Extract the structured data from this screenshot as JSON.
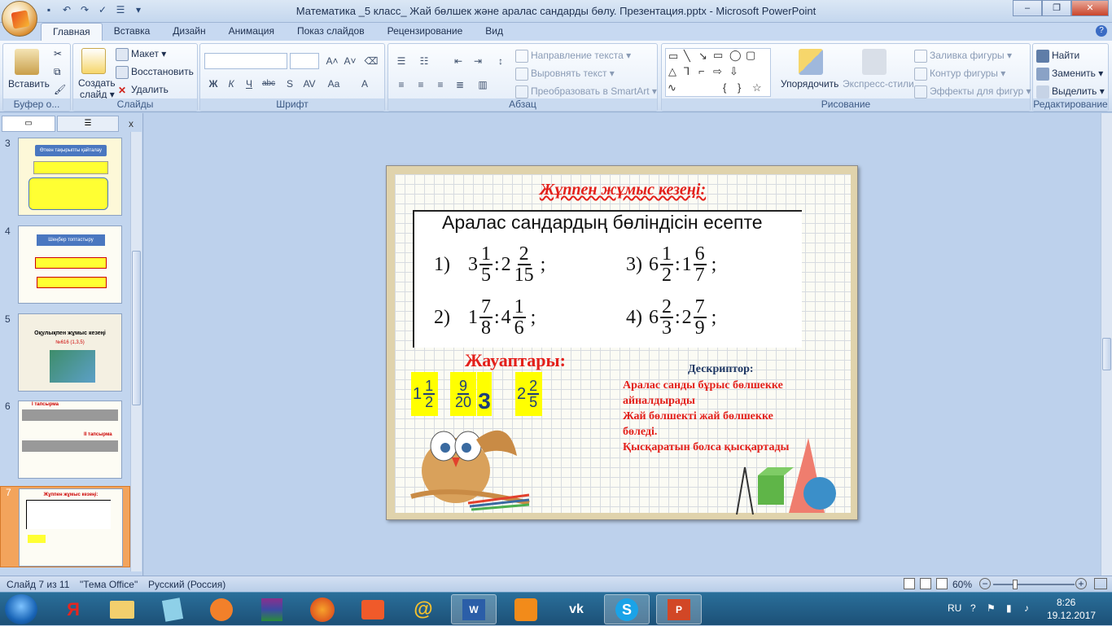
{
  "window": {
    "title": "Математика _5 класс_ Жай бөлшек және аралас сандарды бөлу. Презентация.pptx - Microsoft PowerPoint",
    "minimize": "–",
    "maximize": "❐",
    "close": "✕"
  },
  "tabs": [
    "Главная",
    "Вставка",
    "Дизайн",
    "Анимация",
    "Показ слайдов",
    "Рецензирование",
    "Вид"
  ],
  "ribbon": {
    "clipboard": {
      "label": "Буфер о...",
      "paste": "Вставить"
    },
    "slides": {
      "label": "Слайды",
      "new_slide": "Создать",
      "new_slide2": "слайд ▾",
      "layout": "Макет ▾",
      "reset": "Восстановить",
      "delete": "Удалить"
    },
    "font": {
      "label": "Шрифт"
    },
    "paragraph": {
      "label": "Абзац",
      "text_direction": "Направление текста ▾",
      "align_text": "Выровнять текст ▾",
      "smartart": "Преобразовать в SmartArt ▾"
    },
    "drawing": {
      "label": "Рисование",
      "arrange": "Упорядочить",
      "quick_styles": "Экспресс-стили",
      "fill": "Заливка фигуры ▾",
      "outline": "Контур фигуры ▾",
      "effects": "Эффекты для фигур ▾"
    },
    "editing": {
      "label": "Редактирование",
      "find": "Найти",
      "replace": "Заменить ▾",
      "select": "Выделить ▾"
    }
  },
  "thumbnails": [
    {
      "num": "3",
      "title": "Өткен тақырыпты қайталау"
    },
    {
      "num": "4",
      "title": "Шеңбер топтастыру"
    },
    {
      "num": "5",
      "title": "Оқулықпен жұмыс кезеңі",
      "sub": "№616 (1,3,5)"
    },
    {
      "num": "6",
      "title": "І тапсырма",
      "sub": "ІІ тапсырма"
    },
    {
      "num": "7",
      "title": "Жұппен жұмыс кезеңі:"
    }
  ],
  "slide": {
    "title": "Жұппен жұмыс  кезеңі:",
    "task_heading": "Аралас сандардың бөліндісін есепте",
    "problems": [
      {
        "num": "1)",
        "a_whole": "3",
        "a_n": "1",
        "a_d": "5",
        "b_whole": "2",
        "b_n": "2",
        "b_d": "15"
      },
      {
        "num": "3)",
        "a_whole": "6",
        "a_n": "1",
        "a_d": "2",
        "b_whole": "1",
        "b_n": "6",
        "b_d": "7"
      },
      {
        "num": "2)",
        "a_whole": "1",
        "a_n": "7",
        "a_d": "8",
        "b_whole": "4",
        "b_n": "1",
        "b_d": "6"
      },
      {
        "num": "4)",
        "a_whole": "6",
        "a_n": "2",
        "a_d": "3",
        "b_whole": "2",
        "b_n": "7",
        "b_d": "9"
      }
    ],
    "colon": ":",
    "semicolon": ";",
    "answers_title": "Жауаптары:",
    "answers": [
      {
        "whole": "1",
        "n": "1",
        "d": "2"
      },
      {
        "whole": "",
        "n": "9",
        "d": "20"
      },
      {
        "whole": "3",
        "n": "",
        "d": ""
      },
      {
        "whole": "2",
        "n": "2",
        "d": "5"
      }
    ],
    "descriptor_title": "Дескриптор:",
    "descriptor_lines": [
      "Аралас санды бұрыс бөлшекке",
      "айналдырады",
      "Жай бөлшекті жай бөлшекке",
      "бөледі.",
      "Қысқаратын болса қысқартады"
    ]
  },
  "status": {
    "slide": "Слайд 7 из 11",
    "theme": "\"Тема Office\"",
    "language": "Русский (Россия)",
    "zoom": "60%"
  },
  "tray": {
    "lang": "RU",
    "time": "8:26",
    "date": "19.12.2017"
  }
}
